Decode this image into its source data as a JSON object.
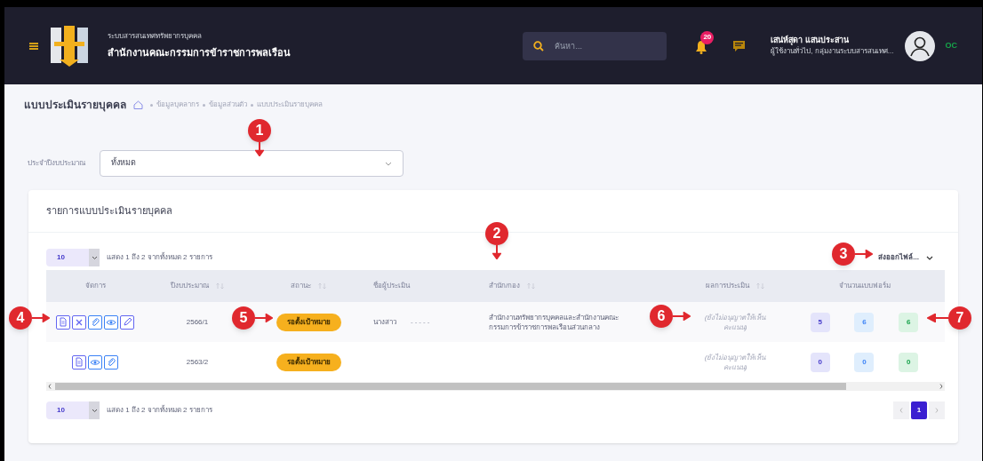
{
  "header": {
    "system_name": "ระบบสารสนเทศทรัพยากรบุคคล",
    "org_name": "สำนักงานคณะกรรมการข้าราชการพลเรือน",
    "search": {
      "placeholder": "ค้นหา..."
    },
    "notification_count": "20",
    "user": {
      "name": "เสน่ห์สุดา แสนประสาน",
      "role": "ผู้ใช้งานทั่วไป, กลุ่มงานระบบสารสนเทศ...",
      "initials": "OC"
    }
  },
  "page_title": "แบบประเมินรายบุคคล",
  "breadcrumb": [
    "ข้อมูลบุคลากร",
    "ข้อมูลส่วนตัว",
    "แบบประเมินรายบุคคล"
  ],
  "filter": {
    "label": "ประจำปีงบประมาณ",
    "value": "ทั้งหมด"
  },
  "card": {
    "title": "รายการแบบประเมินรายบุคคล",
    "top_controls": {
      "page_size": "10",
      "info": "แสดง 1 ถึง 2 จากทั้งหมด 2 รายการ"
    },
    "bottom_controls": {
      "page_size": "10",
      "info": "แสดง 1 ถึง 2 จากทั้งหมด 2 รายการ"
    },
    "export": "ส่งออกไฟล์...",
    "columns": [
      {
        "label": "จัดการ",
        "sortable": false
      },
      {
        "label": "ปีงบประมาณ",
        "sortable": true
      },
      {
        "label": "สถานะ",
        "sortable": true
      },
      {
        "label": "ชื่อผู้ประเมิน",
        "sortable": false
      },
      {
        "label": "สำนัก/กอง",
        "sortable": true
      },
      {
        "label": "ผลการประเมิน",
        "sortable": true
      },
      {
        "label": "จำนวนแบบฟอร์ม",
        "sortable": false
      }
    ],
    "rows": [
      {
        "actions": [
          {
            "kind": "document"
          },
          {
            "kind": "cross"
          },
          {
            "kind": "clip"
          },
          {
            "kind": "eye"
          },
          {
            "kind": "pen"
          }
        ],
        "year": "2566/1",
        "status": "รอตั้งเป้าหมาย",
        "evaluator": "นางสาว",
        "evaluator_masked": "-----",
        "department": "สำนักงานทรัพยากรบุคคลและสำนักงานคณะกรรมการข้าราชการพลเรือนส่วนกลาง",
        "result": "(ยังไม่อนุญาตให้เห็นคะแนน)",
        "counts": [
          {
            "value": "5",
            "color": "#e4e4fb"
          },
          {
            "value": "6",
            "color": "#dfeefd"
          },
          {
            "value": "6",
            "color": "#dcf4e4"
          }
        ]
      },
      {
        "actions": [
          {
            "kind": "document"
          },
          {
            "kind": "eye"
          },
          {
            "kind": "clip"
          }
        ],
        "year": "2563/2",
        "status": "รอตั้งเป้าหมาย",
        "result": "(ยังไม่อนุญาตให้เห็นคะแนน)",
        "counts": [
          {
            "value": "0",
            "color": "#e4e4fb"
          },
          {
            "value": "0",
            "color": "#dfeefd"
          },
          {
            "value": "0",
            "color": "#dcf4e4"
          }
        ]
      }
    ],
    "pagination": {
      "pages": [
        {
          "label": "1",
          "selected": true
        }
      ]
    }
  },
  "callouts": [
    {
      "number": "1"
    },
    {
      "number": "2"
    },
    {
      "number": "3"
    },
    {
      "number": "4"
    },
    {
      "number": "5"
    },
    {
      "number": "6"
    },
    {
      "number": "7"
    }
  ]
}
